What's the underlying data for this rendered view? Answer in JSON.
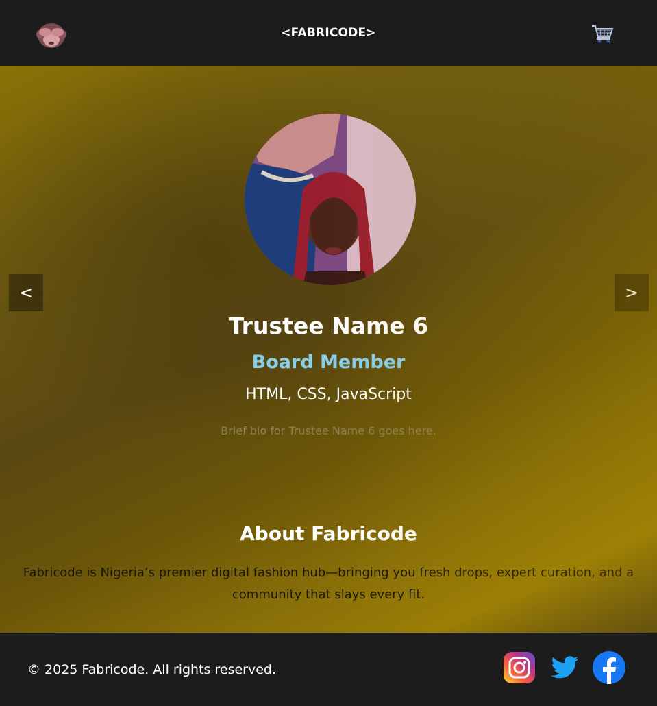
{
  "header": {
    "brand": "<FABRICODE>",
    "logo_icon": "see-no-evil-monkey-icon",
    "cart_icon": "shopping-cart-icon"
  },
  "carousel": {
    "prev_label": "<",
    "next_label": ">",
    "trustee": {
      "name": "Trustee Name 6",
      "role": "Board Member",
      "skills": "HTML, CSS, JavaScript",
      "bio": "Brief bio for Trustee Name 6 goes here."
    }
  },
  "about": {
    "title": "About Fabricode",
    "text": "Fabricode is Nigeria’s premier digital fashion hub—bringing you fresh drops, expert curation, and a community that slays every fit."
  },
  "footer": {
    "copyright": "© 2025 Fabricode. All rights reserved.",
    "social": [
      "instagram-icon",
      "twitter-icon",
      "facebook-icon"
    ]
  },
  "colors": {
    "header_bg": "#1c1c1c",
    "role_accent": "#87ceeb",
    "gold": "#8a7206"
  }
}
